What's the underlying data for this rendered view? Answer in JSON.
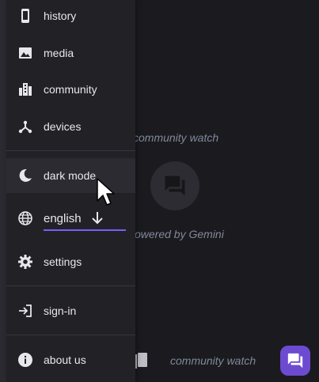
{
  "menu": {
    "items": [
      {
        "id": "history",
        "label": "history",
        "icon": "phone-icon"
      },
      {
        "id": "media",
        "label": "media",
        "icon": "image-icon"
      },
      {
        "id": "community",
        "label": "community",
        "icon": "buildings-icon"
      },
      {
        "id": "devices",
        "label": "devices",
        "icon": "hub-icon"
      },
      {
        "id": "dark_mode",
        "label": "dark mode",
        "icon": "moon-icon"
      },
      {
        "id": "language",
        "label": "english",
        "icon": "globe-icon"
      },
      {
        "id": "settings",
        "label": "settings",
        "icon": "gear-icon"
      },
      {
        "id": "sign_in",
        "label": "sign-in",
        "icon": "login-icon"
      },
      {
        "id": "about_us",
        "label": "about us",
        "icon": "info-icon"
      }
    ]
  },
  "background": {
    "text_1": "community watch",
    "text_2": "owered by Gemini",
    "text_3": "community watch"
  },
  "colors": {
    "accent": "#7b5cff",
    "fab": "#6c4bd0",
    "drawer": "#222126",
    "background": "#1b1a1f"
  }
}
